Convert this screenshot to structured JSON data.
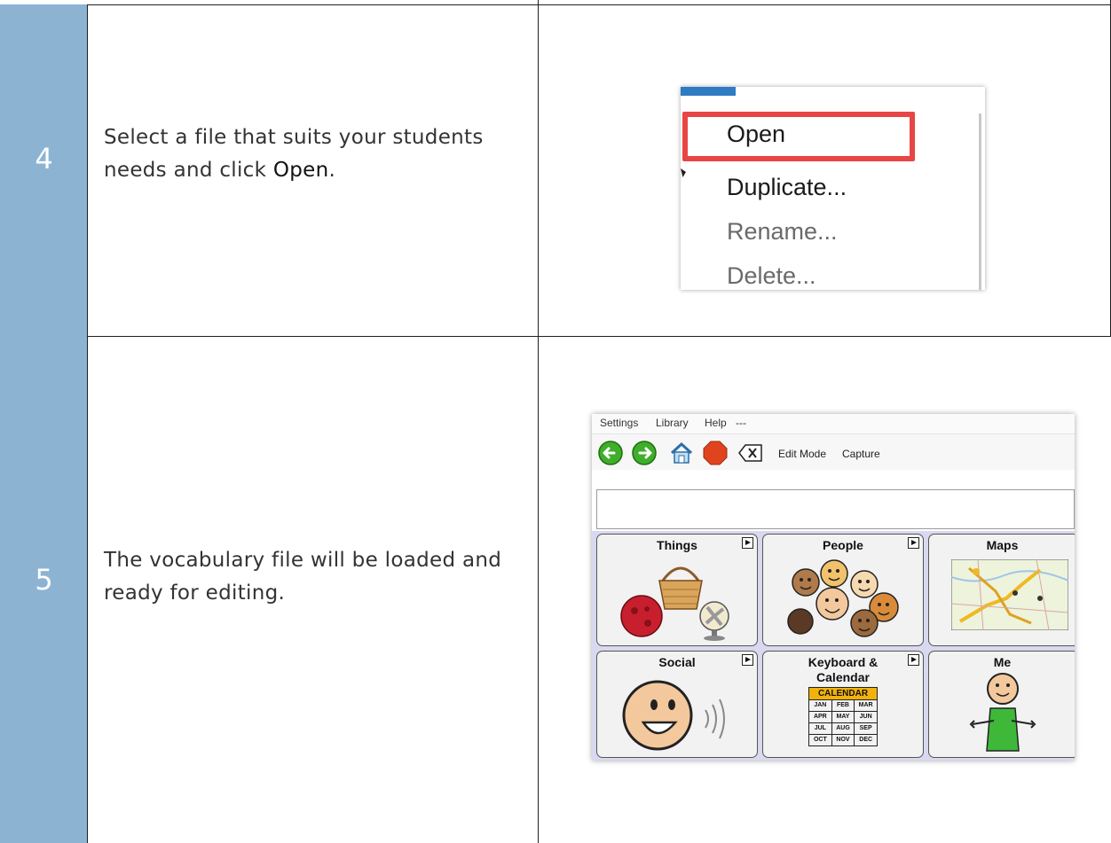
{
  "rows": [
    {
      "step": "4",
      "text_before": "Select a file that suits your students needs and click ",
      "text_bold": "Open",
      "text_after": ".",
      "context_menu": {
        "items": [
          "Open",
          "Duplicate...",
          "Rename...",
          "Delete..."
        ],
        "highlight_color": "#e84545"
      }
    },
    {
      "step": "5",
      "text": "The vocabulary file will be loaded and ready for editing.",
      "app": {
        "menu": [
          "Settings",
          "Library",
          "Help",
          "---"
        ],
        "toolbar": {
          "back_icon": "green-left-arrow",
          "forward_icon": "green-right-arrow",
          "home_icon": "house",
          "stop_icon": "red-stop-octagon",
          "clear_icon": "backspace-x",
          "edit_mode": "Edit Mode",
          "capture": "Capture"
        },
        "tiles": [
          {
            "label": "Things"
          },
          {
            "label": "People"
          },
          {
            "label": "Maps"
          },
          {
            "label": "Social"
          },
          {
            "label": "Keyboard &\nCalendar"
          },
          {
            "label": "Me"
          }
        ],
        "calendar": {
          "title": "CALENDAR",
          "months": [
            "JAN",
            "FEB",
            "MAR",
            "APR",
            "MAY",
            "JUN",
            "JUL",
            "AUG",
            "SEP",
            "OCT",
            "NOV",
            "DEC"
          ]
        }
      }
    }
  ],
  "colors": {
    "step_column": "#8db3d2",
    "tile_background": "#f2f2f2",
    "grid_background": "#d8d8ee",
    "calendar_header": "#f2b20c"
  }
}
